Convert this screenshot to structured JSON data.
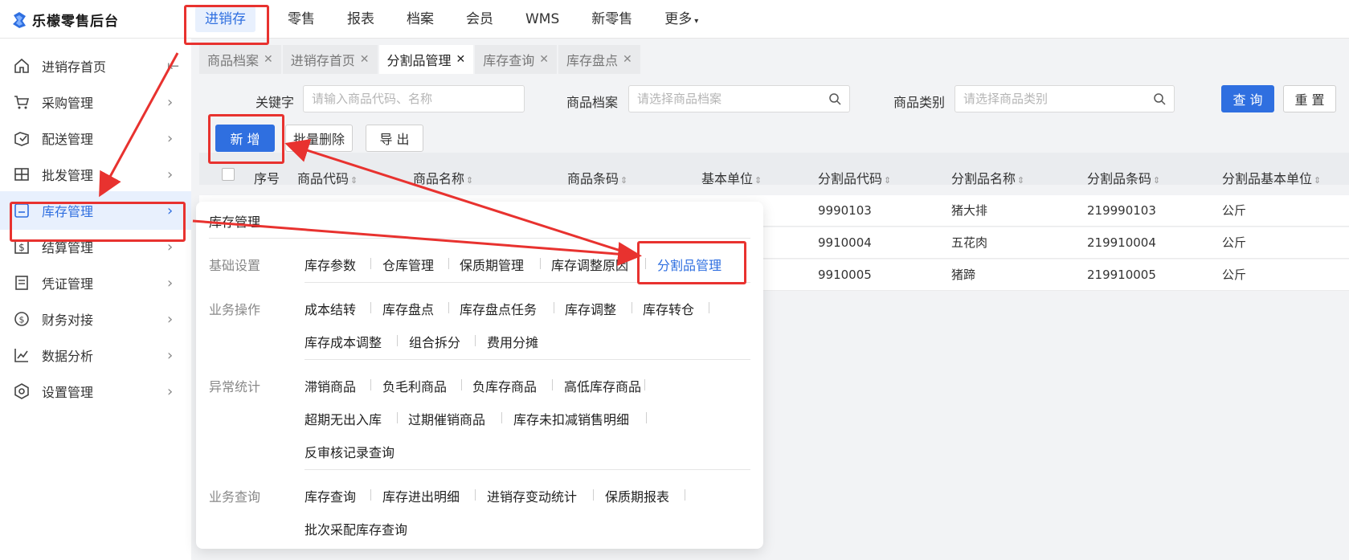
{
  "app": {
    "title": "乐檬零售后台"
  },
  "topnav": {
    "items": [
      "进销存",
      "零售",
      "报表",
      "档案",
      "会员",
      "WMS",
      "新零售",
      "更多"
    ],
    "active_index": 0
  },
  "sidebar": {
    "items": [
      {
        "label": "进销存首页",
        "icon": "home-icon"
      },
      {
        "label": "采购管理",
        "icon": "cart-icon"
      },
      {
        "label": "配送管理",
        "icon": "delivery-icon"
      },
      {
        "label": "批发管理",
        "icon": "wholesale-icon"
      },
      {
        "label": "库存管理",
        "icon": "inventory-icon"
      },
      {
        "label": "结算管理",
        "icon": "settlement-icon"
      },
      {
        "label": "凭证管理",
        "icon": "voucher-icon"
      },
      {
        "label": "财务对接",
        "icon": "finance-icon"
      },
      {
        "label": "数据分析",
        "icon": "chart-icon"
      },
      {
        "label": "设置管理",
        "icon": "settings-icon"
      }
    ],
    "active_index": 4
  },
  "tabs": {
    "items": [
      "商品档案",
      "进销存首页",
      "分割品管理",
      "库存查询",
      "库存盘点"
    ],
    "active_index": 2
  },
  "filters": {
    "keyword_label": "关键字",
    "keyword_placeholder": "请输入商品代码、名称",
    "product_label": "商品档案",
    "product_placeholder": "请选择商品档案",
    "category_label": "商品类别",
    "category_placeholder": "请选择商品类别",
    "query_button": "查 询",
    "reset_button": "重 置"
  },
  "actions": {
    "add_button": "新 增",
    "batch_delete_button": "批量删除",
    "export_button": "导 出"
  },
  "table": {
    "columns": [
      "序号",
      "商品代码",
      "商品名称",
      "商品条码",
      "基本单位",
      "分割品代码",
      "分割品名称",
      "分割品条码",
      "分割品基本单位"
    ],
    "rows": [
      {
        "split_code": "9990103",
        "split_name": "猪大排",
        "split_barcode": "219990103",
        "split_unit": "公斤"
      },
      {
        "split_code": "9910004",
        "split_name": "五花肉",
        "split_barcode": "219910004",
        "split_unit": "公斤"
      },
      {
        "split_code": "9910005",
        "split_name": "猪蹄",
        "split_barcode": "219910005",
        "split_unit": "公斤"
      }
    ]
  },
  "menu": {
    "title": "库存管理",
    "groups": [
      {
        "label": "基础设置",
        "links": [
          "库存参数",
          "仓库管理",
          "保质期管理",
          "库存调整原因",
          "分割品管理"
        ]
      },
      {
        "label": "业务操作",
        "links": [
          "成本结转",
          "库存盘点",
          "库存盘点任务",
          "库存调整",
          "库存转仓",
          "库存成本调整",
          "组合拆分",
          "费用分摊"
        ]
      },
      {
        "label": "异常统计",
        "links": [
          "滞销商品",
          "负毛利商品",
          "负库存商品",
          "高低库存商品",
          "超期无出入库",
          "过期催销商品",
          "库存未扣减销售明细",
          "反审核记录查询"
        ]
      },
      {
        "label": "业务查询",
        "links": [
          "库存查询",
          "库存进出明细",
          "进销存变动统计",
          "保质期报表",
          "批次采配库存查询"
        ]
      }
    ]
  },
  "colors": {
    "accent": "#2f6fe0",
    "annotation": "#e8322f"
  }
}
